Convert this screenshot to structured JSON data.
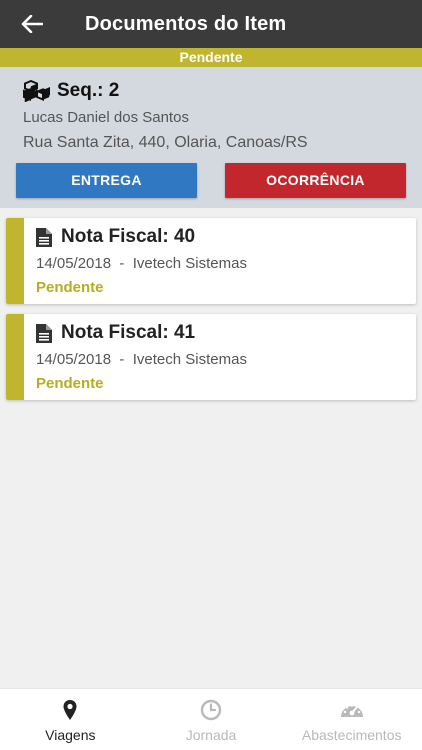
{
  "appbar": {
    "title": "Documentos do Item",
    "back_icon": "arrow-left-icon"
  },
  "status": {
    "label": "Pendente",
    "color": "#bfb52e"
  },
  "item": {
    "seq_label": "Seq.: 2",
    "seq_icon": "boxes-icon",
    "name": "Lucas Daniel dos Santos",
    "address": "Rua Santa Zita, 440, Olaria, Canoas/RS"
  },
  "actions": {
    "entrega": {
      "label": "ENTREGA",
      "color": "#3178c3"
    },
    "ocorrencia": {
      "label": "OCORRÊNCIA",
      "color": "#c2272d"
    }
  },
  "documents": [
    {
      "title": "Nota Fiscal:  40",
      "date": "14/05/2018",
      "separator": "  -  ",
      "company": "Ivetech Sistemas",
      "status": "Pendente",
      "icon": "document-icon"
    },
    {
      "title": "Nota Fiscal:  41",
      "date": "14/05/2018",
      "separator": "  -  ",
      "company": "Ivetech Sistemas",
      "status": "Pendente",
      "icon": "document-icon"
    }
  ],
  "bottom_nav": [
    {
      "label": "Viagens",
      "icon": "map-pin-icon",
      "active": true
    },
    {
      "label": "Jornada",
      "icon": "clock-icon",
      "active": false
    },
    {
      "label": "Abastecimentos",
      "icon": "gauge-icon",
      "active": false
    }
  ]
}
